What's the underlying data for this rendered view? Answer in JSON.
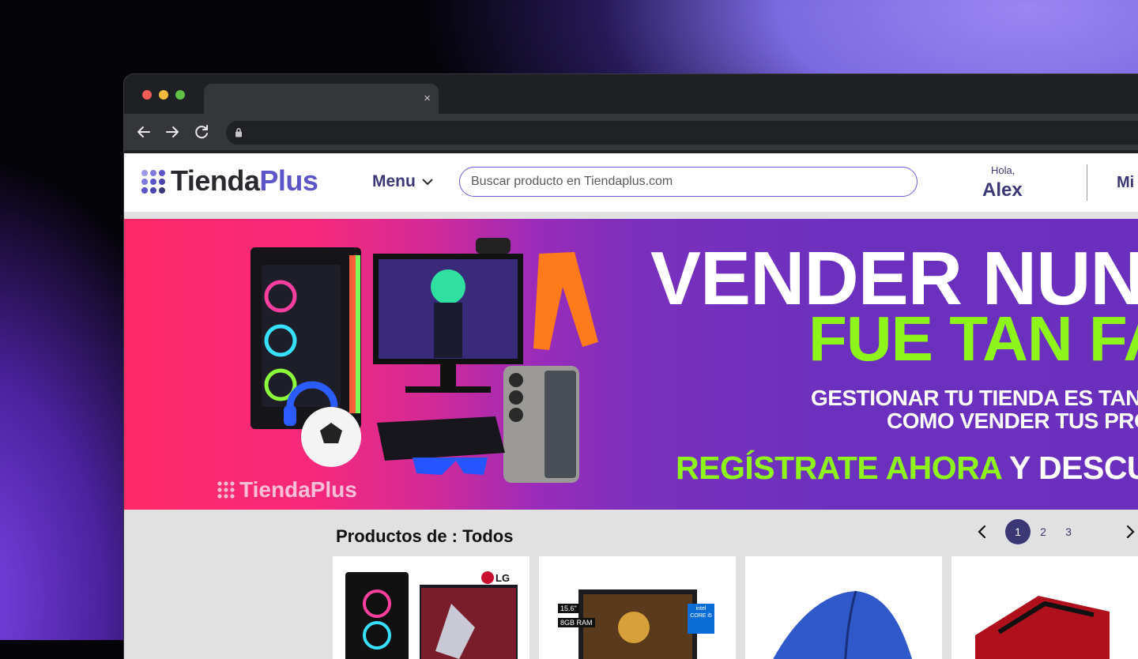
{
  "browser": {
    "tab_title": "",
    "close_symbol": "×",
    "url": ""
  },
  "header": {
    "logo_part1": "Tienda",
    "logo_part2": "Plus",
    "menu_label": "Menu",
    "search_placeholder": "Buscar producto en Tiendaplus.com",
    "greeting": "Hola,",
    "user_name": "Alex",
    "account_link": "Mi"
  },
  "banner": {
    "line1": "VENDER NUNC",
    "line2": "FUE TAN FAC",
    "line3": "GESTIONAR TU TIENDA ES TAN SEN",
    "line4": "COMO VENDER TUS PRODU",
    "cta_highlight": "REGÍSTRATE AHORA",
    "cta_rest": " Y DESCUBRE",
    "watermark": "TiendaPlus"
  },
  "products": {
    "title": "Productos de : Todos",
    "pages": [
      "1",
      "2",
      "3"
    ],
    "active_page": "1",
    "cards": [
      {
        "brand_badge": "LG"
      },
      {
        "spec1": "15.6\"",
        "spec2": "8GB RAM",
        "badge": "intel CORE i5"
      },
      {},
      {}
    ]
  },
  "colors": {
    "brand_purple": "#5b55c8",
    "dark_purple": "#3c3876",
    "lime": "#8ef51a",
    "banner_pink": "#ff2a6a",
    "banner_violet": "#6a30bd"
  }
}
